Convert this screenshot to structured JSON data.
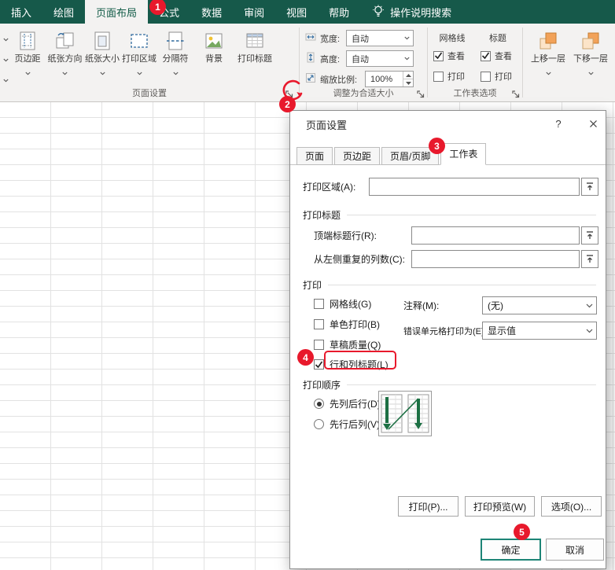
{
  "menubar": {
    "tabs": [
      {
        "label": "插入",
        "selected": false
      },
      {
        "label": "绘图",
        "selected": false
      },
      {
        "label": "页面布局",
        "selected": true
      },
      {
        "label": "公式",
        "selected": false
      },
      {
        "label": "数据",
        "selected": false
      },
      {
        "label": "审阅",
        "selected": false
      },
      {
        "label": "视图",
        "selected": false
      },
      {
        "label": "帮助",
        "selected": false
      }
    ],
    "search_label": "操作说明搜索"
  },
  "ribbon": {
    "page_setup": {
      "group_label": "页面设置",
      "buttons": [
        {
          "label": "页边距",
          "has_dropdown": true
        },
        {
          "label": "纸张方向",
          "has_dropdown": true
        },
        {
          "label": "纸张大小",
          "has_dropdown": true
        },
        {
          "label": "打印区域",
          "has_dropdown": true
        },
        {
          "label": "分隔符",
          "has_dropdown": true
        },
        {
          "label": "背景",
          "has_dropdown": false
        },
        {
          "label": "打印标题",
          "has_dropdown": false
        }
      ]
    },
    "scale_to_fit": {
      "group_label": "调整为合适大小",
      "width_label": "宽度:",
      "width_value": "自动",
      "height_label": "高度:",
      "height_value": "自动",
      "scale_label": "缩放比例:",
      "scale_value": "100%"
    },
    "sheet_options": {
      "group_label": "工作表选项",
      "gridlines_header": "网格线",
      "headings_header": "标题",
      "view_label": "查看",
      "print_label": "打印",
      "gridlines_view_checked": true,
      "gridlines_print_checked": false,
      "headings_view_checked": true,
      "headings_print_checked": false
    },
    "arrange": {
      "bring_forward_label": "上移一层",
      "send_backward_label": "下移一层"
    }
  },
  "dialog": {
    "title": "页面设置",
    "help_icon_label": "?",
    "tabs": [
      {
        "label": "页面",
        "selected": false
      },
      {
        "label": "页边距",
        "selected": false
      },
      {
        "label": "页眉/页脚",
        "selected": false
      },
      {
        "label": "工作表",
        "selected": true
      }
    ],
    "print_area_label": "打印区域(A):",
    "print_area_value": "",
    "print_titles_section": "打印标题",
    "top_title_rows_label": "顶端标题行(R):",
    "top_title_rows_value": "",
    "left_repeat_cols_label": "从左侧重复的列数(C):",
    "left_repeat_cols_value": "",
    "print_section": "打印",
    "checkbox_gridlines": "网格线(G)",
    "checkbox_gridlines_checked": false,
    "checkbox_bw": "单色打印(B)",
    "checkbox_bw_checked": false,
    "checkbox_draft": "草稿质量(Q)",
    "checkbox_draft_checked": false,
    "checkbox_headings": "行和列标题(L)",
    "checkbox_headings_checked": true,
    "comments_label": "注释(M):",
    "comments_value": "(无)",
    "cell_errors_label": "错误单元格打印为(E):",
    "cell_errors_value": "显示值",
    "page_order_section": "打印顺序",
    "radio_down_then_over": "先列后行(D)",
    "radio_down_then_over_selected": true,
    "radio_over_then_down": "先行后列(V)",
    "radio_over_then_down_selected": false,
    "print_button": "打印(P)...",
    "print_preview_button": "打印预览(W)",
    "options_button": "选项(O)...",
    "ok_button": "确定",
    "cancel_button": "取消"
  },
  "annotations": {
    "steps": [
      "1",
      "2",
      "3",
      "4",
      "5"
    ]
  },
  "colors": {
    "menubar_green": "#16594a",
    "ribbon_bg": "#f3f2f1",
    "annotation_red": "#e8192c",
    "ok_accent_teal": "#1d8476",
    "arrow_green": "#1d7044"
  }
}
